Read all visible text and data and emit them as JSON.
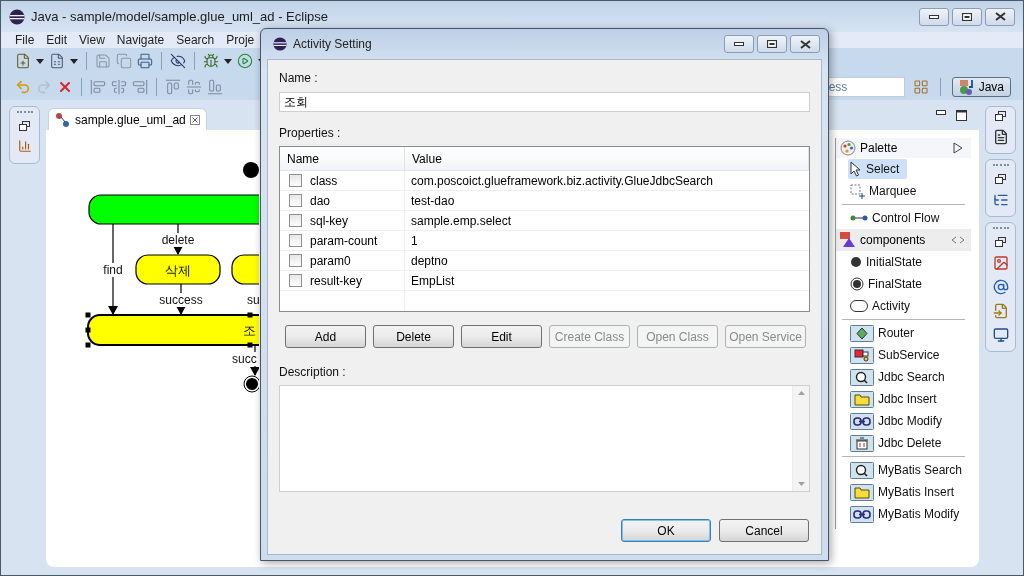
{
  "window": {
    "title": "Java - sample/model/sample.glue_uml_ad - Eclipse"
  },
  "menu_bar": [
    "File",
    "Edit",
    "View",
    "Navigate",
    "Search",
    "Proje"
  ],
  "quick_access": {
    "placeholder": "ess"
  },
  "perspective": {
    "label": "Java",
    "selected": true
  },
  "editor": {
    "tab": {
      "label": "sample.glue_uml_ad",
      "selected": true
    }
  },
  "diagram": {
    "nodes": [
      {
        "kind": "initial"
      },
      {
        "kind": "activity",
        "color": "#00ff00",
        "selected": false
      },
      {
        "kind": "activity",
        "label": "삭제",
        "color": "#ffff00",
        "selected": false
      },
      {
        "kind": "activity",
        "color": "#ffff00",
        "selected": false
      },
      {
        "kind": "activity",
        "label": "조",
        "color": "#ffff00",
        "selected": true
      },
      {
        "kind": "final"
      }
    ],
    "edges": [
      {
        "label": "delete"
      },
      {
        "label": "find"
      },
      {
        "label": "success"
      },
      {
        "label": "su"
      },
      {
        "label": "succ"
      }
    ]
  },
  "palette": {
    "title": "Palette",
    "items": [
      {
        "kind": "select",
        "label": "Select",
        "selected": true
      },
      {
        "kind": "marquee",
        "label": "Marquee",
        "selected": false
      },
      {
        "kind": "separator"
      },
      {
        "kind": "flow",
        "label": "Control Flow",
        "selected": false
      },
      {
        "kind": "drawer",
        "label": "components"
      },
      {
        "kind": "initial",
        "label": "InitialState",
        "selected": false
      },
      {
        "kind": "final",
        "label": "FinalState",
        "selected": false
      },
      {
        "kind": "activity",
        "label": "Activity",
        "selected": false
      },
      {
        "kind": "separator"
      },
      {
        "kind": "router",
        "label": "Router",
        "selected": false
      },
      {
        "kind": "subservice",
        "label": "SubService",
        "selected": false
      },
      {
        "kind": "search",
        "label": "Jdbc Search",
        "selected": false
      },
      {
        "kind": "insert",
        "label": "Jdbc Insert",
        "selected": false
      },
      {
        "kind": "modify",
        "label": "Jdbc Modify",
        "selected": false
      },
      {
        "kind": "delete",
        "label": "Jdbc Delete",
        "selected": false
      },
      {
        "kind": "separator"
      },
      {
        "kind": "search",
        "label": "MyBatis Search",
        "selected": false
      },
      {
        "kind": "insert",
        "label": "MyBatis Insert",
        "selected": false
      },
      {
        "kind": "modify",
        "label": "MyBatis Modify",
        "selected": false
      }
    ]
  },
  "dialog": {
    "title": "Activity Setting",
    "name_label": "Name :",
    "name_value": "조회",
    "properties_label": "Properties :",
    "columns": [
      "Name",
      "Value"
    ],
    "rows": [
      {
        "checked": false,
        "name": "class",
        "value": "com.poscoict.glueframework.biz.activity.GlueJdbcSearch"
      },
      {
        "checked": false,
        "name": "dao",
        "value": "test-dao"
      },
      {
        "checked": false,
        "name": "sql-key",
        "value": "sample.emp.select"
      },
      {
        "checked": false,
        "name": "param-count",
        "value": "1"
      },
      {
        "checked": false,
        "name": "param0",
        "value": "deptno"
      },
      {
        "checked": false,
        "name": "result-key",
        "value": "EmpList"
      }
    ],
    "buttons": [
      {
        "label": "Add",
        "disabled": false
      },
      {
        "label": "Delete",
        "disabled": false
      },
      {
        "label": "Edit",
        "disabled": false
      },
      {
        "label": "Create Class",
        "disabled": true
      },
      {
        "label": "Open Class",
        "disabled": true
      },
      {
        "label": "Open Service",
        "disabled": true
      }
    ],
    "description_label": "Description :",
    "footer_buttons": [
      {
        "label": "OK",
        "default": true
      },
      {
        "label": "Cancel",
        "default": false
      }
    ]
  }
}
